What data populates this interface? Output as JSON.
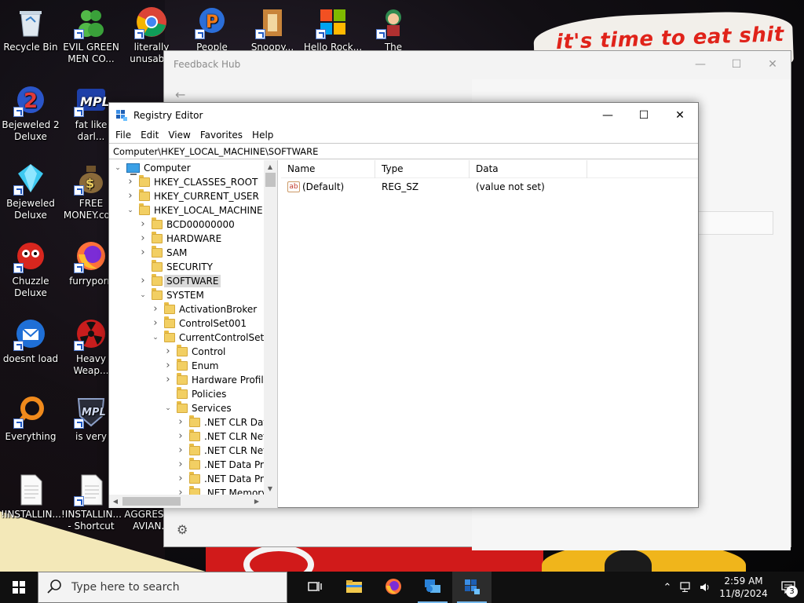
{
  "wallpaper": {
    "caption": "it's time to eat shit"
  },
  "desktop_icons": [
    {
      "label": "Recycle Bin",
      "icon": "recycle-bin-icon",
      "shortcut": false
    },
    {
      "label": "EVIL GREEN\nMEN CO...",
      "icon": "green-men-icon",
      "shortcut": true
    },
    {
      "label": "literally\nunusab...",
      "icon": "chrome-icon",
      "shortcut": true
    },
    {
      "label": "People Night...",
      "icon": "people-icon",
      "shortcut": true
    },
    {
      "label": "Snoopy...",
      "icon": "snoopy-icon",
      "shortcut": true
    },
    {
      "label": "Hello Rock...",
      "icon": "windows-logo-icon",
      "shortcut": true
    },
    {
      "label": "The Legend...",
      "icon": "legend-character-icon",
      "shortcut": true
    },
    {
      "label": "Bejeweled 2\nDeluxe",
      "icon": "bejeweled-2-icon",
      "shortcut": true
    },
    {
      "label": "fat like darl...",
      "icon": "mpl-icon",
      "shortcut": true
    },
    {
      "label": "Bejeweled\nDeluxe",
      "icon": "diamond-icon",
      "shortcut": true
    },
    {
      "label": "FREE\nMONEY.co...",
      "icon": "money-bag-icon",
      "shortcut": true
    },
    {
      "label": "Chuzzle\nDeluxe",
      "icon": "chuzzle-icon",
      "shortcut": true
    },
    {
      "label": "furryporn",
      "icon": "firefox-icon",
      "shortcut": true
    },
    {
      "label": "doesnt load",
      "icon": "thunderbird-icon",
      "shortcut": true
    },
    {
      "label": "Heavy\nWeap...",
      "icon": "radiation-icon",
      "shortcut": true
    },
    {
      "label": "Everything",
      "icon": "search-ring-icon",
      "shortcut": true
    },
    {
      "label": "is very",
      "icon": "mpl-shield-icon",
      "shortcut": true
    },
    {
      "label": "!INSTALLIN...",
      "icon": "document-icon",
      "shortcut": false
    },
    {
      "label": "!INSTALLIN...\n- Shortcut",
      "icon": "document-icon",
      "shortcut": true
    },
    {
      "label": "AGGRESS...\nAVIAN...",
      "icon": "document-icon",
      "shortcut": false
    }
  ],
  "feedback_hub": {
    "title": "Feedback Hub"
  },
  "regedit": {
    "title": "Registry Editor",
    "menu": [
      "File",
      "Edit",
      "View",
      "Favorites",
      "Help"
    ],
    "address": "Computer\\HKEY_LOCAL_MACHINE\\SOFTWARE",
    "tree": [
      {
        "label": "Computer",
        "depth": 0,
        "state": "open",
        "kind": "pc"
      },
      {
        "label": "HKEY_CLASSES_ROOT",
        "depth": 1,
        "state": "closed"
      },
      {
        "label": "HKEY_CURRENT_USER",
        "depth": 1,
        "state": "closed"
      },
      {
        "label": "HKEY_LOCAL_MACHINE",
        "depth": 1,
        "state": "open"
      },
      {
        "label": "BCD00000000",
        "depth": 2,
        "state": "closed"
      },
      {
        "label": "HARDWARE",
        "depth": 2,
        "state": "closed"
      },
      {
        "label": "SAM",
        "depth": 2,
        "state": "closed"
      },
      {
        "label": "SECURITY",
        "depth": 2,
        "state": "leaf"
      },
      {
        "label": "SOFTWARE",
        "depth": 2,
        "state": "closed",
        "selected": true
      },
      {
        "label": "SYSTEM",
        "depth": 2,
        "state": "open"
      },
      {
        "label": "ActivationBroker",
        "depth": 3,
        "state": "closed"
      },
      {
        "label": "ControlSet001",
        "depth": 3,
        "state": "closed"
      },
      {
        "label": "CurrentControlSet",
        "depth": 3,
        "state": "open"
      },
      {
        "label": "Control",
        "depth": 4,
        "state": "closed"
      },
      {
        "label": "Enum",
        "depth": 4,
        "state": "closed"
      },
      {
        "label": "Hardware Profiles",
        "depth": 4,
        "state": "closed"
      },
      {
        "label": "Policies",
        "depth": 4,
        "state": "leaf"
      },
      {
        "label": "Services",
        "depth": 4,
        "state": "open"
      },
      {
        "label": ".NET CLR Data",
        "depth": 5,
        "state": "closed"
      },
      {
        "label": ".NET CLR Netw",
        "depth": 5,
        "state": "closed"
      },
      {
        "label": ".NET CLR Netw",
        "depth": 5,
        "state": "closed"
      },
      {
        "label": ".NET Data Prov",
        "depth": 5,
        "state": "closed"
      },
      {
        "label": ".NET Data Prov",
        "depth": 5,
        "state": "closed"
      },
      {
        "label": ".NET Memory",
        "depth": 5,
        "state": "closed"
      }
    ],
    "columns": [
      "Name",
      "Type",
      "Data"
    ],
    "values": [
      {
        "name": "(Default)",
        "type": "REG_SZ",
        "data": "(value not set)"
      }
    ]
  },
  "taskbar": {
    "search_placeholder": "Type here to search",
    "apps": [
      {
        "name": "task-view-icon",
        "state": ""
      },
      {
        "name": "file-explorer-icon",
        "state": ""
      },
      {
        "name": "firefox-taskbar-icon",
        "state": ""
      },
      {
        "name": "feedback-hub-icon",
        "state": "run"
      },
      {
        "name": "registry-editor-icon",
        "state": "active"
      }
    ],
    "time": "2:59 AM",
    "date": "11/8/2024",
    "notification_count": "3"
  }
}
